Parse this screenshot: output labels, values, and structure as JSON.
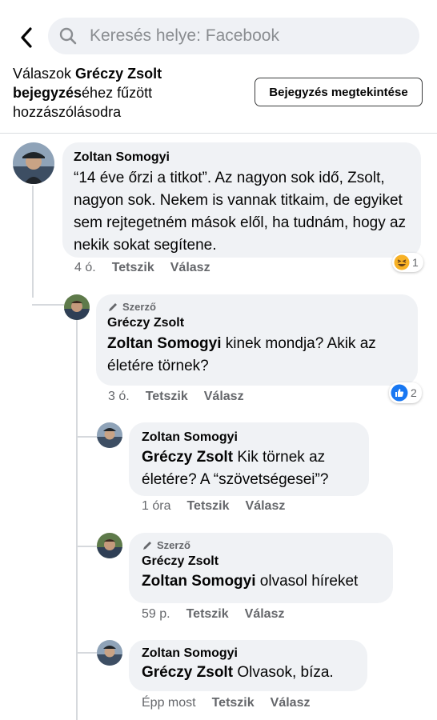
{
  "search": {
    "placeholder": "Keresés helye: Facebook"
  },
  "context": {
    "prefix": "Válaszok ",
    "author": "Gréczy Zsolt",
    "line2_bold": "bejegyzés",
    "line2_rest": "éhez fűzött",
    "line3": "hozzászólásodra",
    "view_post_label": "Bejegyzés megtekintése"
  },
  "comments": [
    {
      "author": "Zoltan Somogyi",
      "text": "“14 éve őrzi a titkot”. Az nagyon sok idő, Zsolt, nagyon sok. Nekem is vannak titkaim, de egyiket sem rejtegetném mások elől, ha tudnám, hogy az nekik sokat segítene.",
      "time": "4 ó.",
      "like": "Tetszik",
      "reply": "Válasz",
      "reaction": {
        "type": "haha",
        "icon": "laugh-emoji-icon",
        "count": "1",
        "color": "#f7b125"
      }
    },
    {
      "badge": "Szerző",
      "author": "Gréczy Zsolt",
      "mention": "Zoltan Somogyi",
      "text": " kinek mondja? Akik az életére törnek?",
      "time": "3 ó.",
      "like": "Tetszik",
      "reply": "Válasz",
      "reaction": {
        "type": "like",
        "icon": "thumbs-up-icon",
        "count": "2",
        "color": "#1877f2"
      }
    },
    {
      "author": "Zoltan Somogyi",
      "mention": "Gréczy Zsolt",
      "text": " Kik törnek az életére? A “szövetségesei”?",
      "time": "1 óra",
      "like": "Tetszik",
      "reply": "Válasz"
    },
    {
      "badge": "Szerző",
      "author": "Gréczy Zsolt",
      "mention": "Zoltan Somogyi",
      "text": " olvasol híreket",
      "time": "59 p.",
      "like": "Tetszik",
      "reply": "Válasz"
    },
    {
      "author": "Zoltan Somogyi",
      "mention": "Gréczy Zsolt",
      "text": " Olvasok, bíza.",
      "time": "Épp most",
      "like": "Tetszik",
      "reply": "Válasz"
    }
  ],
  "colors": {
    "bubble": "#f0f2f5",
    "meta": "#65676b",
    "accent": "#1877f2"
  }
}
